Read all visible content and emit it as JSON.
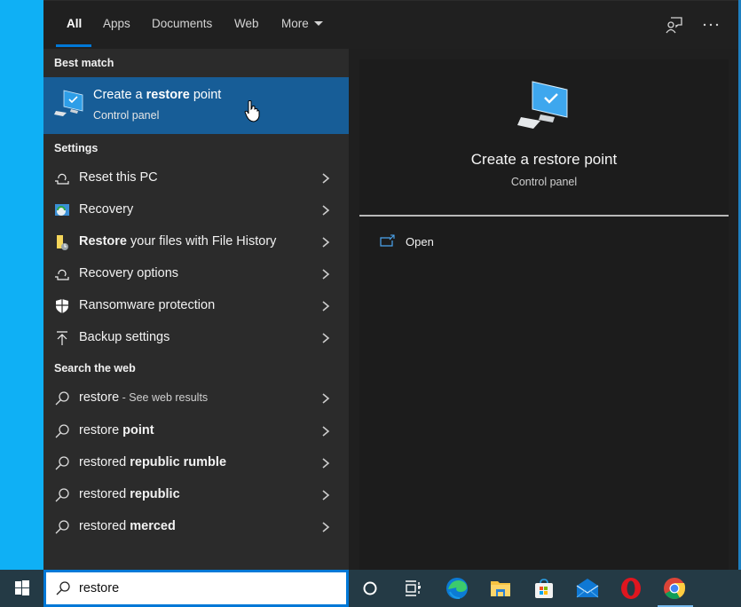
{
  "tabs": [
    {
      "label": "All",
      "active": true
    },
    {
      "label": "Apps"
    },
    {
      "label": "Documents"
    },
    {
      "label": "Web"
    },
    {
      "label": "More"
    }
  ],
  "top_icons": [
    "feedback-icon",
    "more-options-icon"
  ],
  "left": {
    "best_match_header": "Best match",
    "best_match": {
      "title_pre": "Create a ",
      "title_bold": "restore",
      "title_post": " point",
      "subtitle": "Control panel",
      "icon": "computer-check-icon"
    },
    "settings_header": "Settings",
    "settings": [
      {
        "bold": "",
        "text": "Reset this PC",
        "icon": "reset-pc-icon"
      },
      {
        "bold": "",
        "text": "Recovery",
        "icon": "recovery-icon"
      },
      {
        "bold": "Restore",
        "text": " your files with File History",
        "icon": "file-history-icon"
      },
      {
        "bold": "",
        "text": "Recovery options",
        "icon": "recovery-options-icon"
      },
      {
        "bold": "",
        "text": "Ransomware protection",
        "icon": "shield-icon"
      },
      {
        "bold": "",
        "text": "Backup settings",
        "icon": "backup-upload-icon"
      }
    ],
    "web_header": "Search the web",
    "web": [
      {
        "text": "restore",
        "bold": "",
        "suffix": " - See web results"
      },
      {
        "text": "restore ",
        "bold": "point",
        "suffix": ""
      },
      {
        "text": "restored ",
        "bold": "republic rumble",
        "suffix": ""
      },
      {
        "text": "restored ",
        "bold": "republic",
        "suffix": ""
      },
      {
        "text": "restored ",
        "bold": "merced",
        "suffix": ""
      }
    ]
  },
  "preview": {
    "title": "Create a restore point",
    "subtitle": "Control panel",
    "actions": [
      {
        "label": "Open",
        "icon": "open-icon"
      }
    ]
  },
  "taskbar": {
    "search_value": "restore",
    "apps": [
      "cortana",
      "task-view",
      "edge",
      "file-explorer",
      "store",
      "mail",
      "opera",
      "chrome"
    ],
    "active_app": "chrome"
  },
  "colors": {
    "accent": "#0078d7",
    "best_match_bg": "#175d97",
    "desktop": "#00a8f0"
  }
}
